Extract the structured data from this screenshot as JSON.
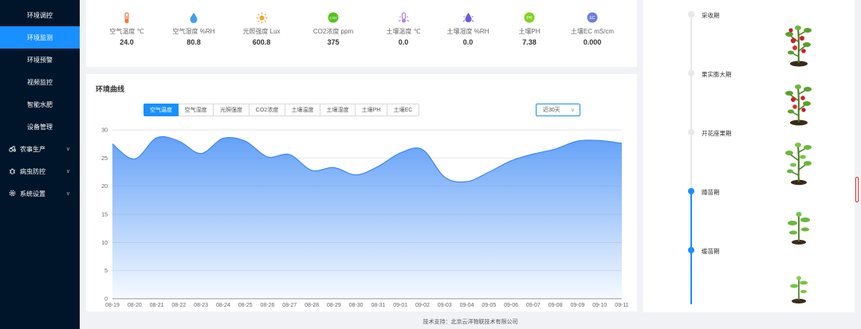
{
  "sidebar": {
    "items": [
      {
        "label": "环境调控"
      },
      {
        "label": "环境监测"
      },
      {
        "label": "环境预警"
      },
      {
        "label": "视频监控"
      },
      {
        "label": "智能水肥"
      },
      {
        "label": "设备管理"
      }
    ],
    "groups": [
      {
        "label": "农事生产",
        "icon": "tractor-icon"
      },
      {
        "label": "病虫防控",
        "icon": "bug-icon"
      },
      {
        "label": "系统设置",
        "icon": "gear-icon"
      }
    ]
  },
  "sensors": [
    {
      "label": "空气温度 ℃",
      "value": "24.0",
      "icon": "thermometer-icon",
      "color": "#f0783c"
    },
    {
      "label": "空气湿度 %RH",
      "value": "80.8",
      "icon": "droplet-icon",
      "color": "#3ca0f0"
    },
    {
      "label": "光照强度 Lux",
      "value": "600.8",
      "icon": "sun-icon",
      "color": "#f5a623"
    },
    {
      "label": "CO2浓度 ppm",
      "value": "375",
      "icon": "co2-icon",
      "color": "#52c41a",
      "badge": "CO2"
    },
    {
      "label": "土壤温度 ℃",
      "value": "0.0",
      "icon": "soil-thermometer-icon",
      "color": "#b37feb"
    },
    {
      "label": "土壤湿度 %RH",
      "value": "0.0",
      "icon": "soil-droplet-icon",
      "color": "#6b5bd6"
    },
    {
      "label": "土壤PH",
      "value": "7.38",
      "icon": "ph-icon",
      "color": "#7ed321",
      "badge": "PH"
    },
    {
      "label": "土壤EC mS/cm",
      "value": "0.000",
      "icon": "ec-icon",
      "color": "#6a7fdb",
      "badge": "EC"
    }
  ],
  "chart_panel": {
    "title": "环境曲线",
    "tabs": [
      "空气温度",
      "空气湿度",
      "光照强度",
      "CO2浓度",
      "土壤温度",
      "土壤湿度",
      "土壤PH",
      "土壤EC"
    ],
    "active_tab": "空气温度",
    "range": "近30天"
  },
  "chart_data": {
    "type": "area",
    "title": "",
    "xlabel": "",
    "ylabel": "",
    "ylim": [
      0,
      30
    ],
    "yticks": [
      0,
      5,
      10,
      15,
      20,
      25,
      30
    ],
    "grid": true,
    "x": [
      "08-19",
      "08-20",
      "08-21",
      "08-22",
      "08-23",
      "08-24",
      "08-25",
      "08-26",
      "08-27",
      "08-28",
      "08-29",
      "08-30",
      "08-31",
      "09-01",
      "09-02",
      "09-03",
      "09-04",
      "09-05",
      "09-06",
      "09-07",
      "09-08",
      "09-09",
      "09-10",
      "09-11"
    ],
    "series": [
      {
        "values": [
          27.5,
          24.8,
          28.6,
          28.0,
          25.8,
          28.5,
          28.0,
          25.2,
          25.6,
          22.8,
          23.3,
          22.0,
          23.5,
          25.9,
          26.5,
          21.6,
          20.8,
          22.5,
          24.5,
          25.7,
          26.6,
          28.0,
          28.1,
          27.6
        ],
        "color": "#5b9cf7"
      }
    ]
  },
  "growth": {
    "stages": [
      {
        "label": "采收期",
        "active": false
      },
      {
        "label": "果实膨大期",
        "active": false
      },
      {
        "label": "开花座果期",
        "active": false
      },
      {
        "label": "蹲苗期",
        "active": true
      },
      {
        "label": "缓苗期",
        "active": true
      }
    ]
  },
  "footer": {
    "text": "技术支持：北京云洋物联技术有限公司"
  }
}
